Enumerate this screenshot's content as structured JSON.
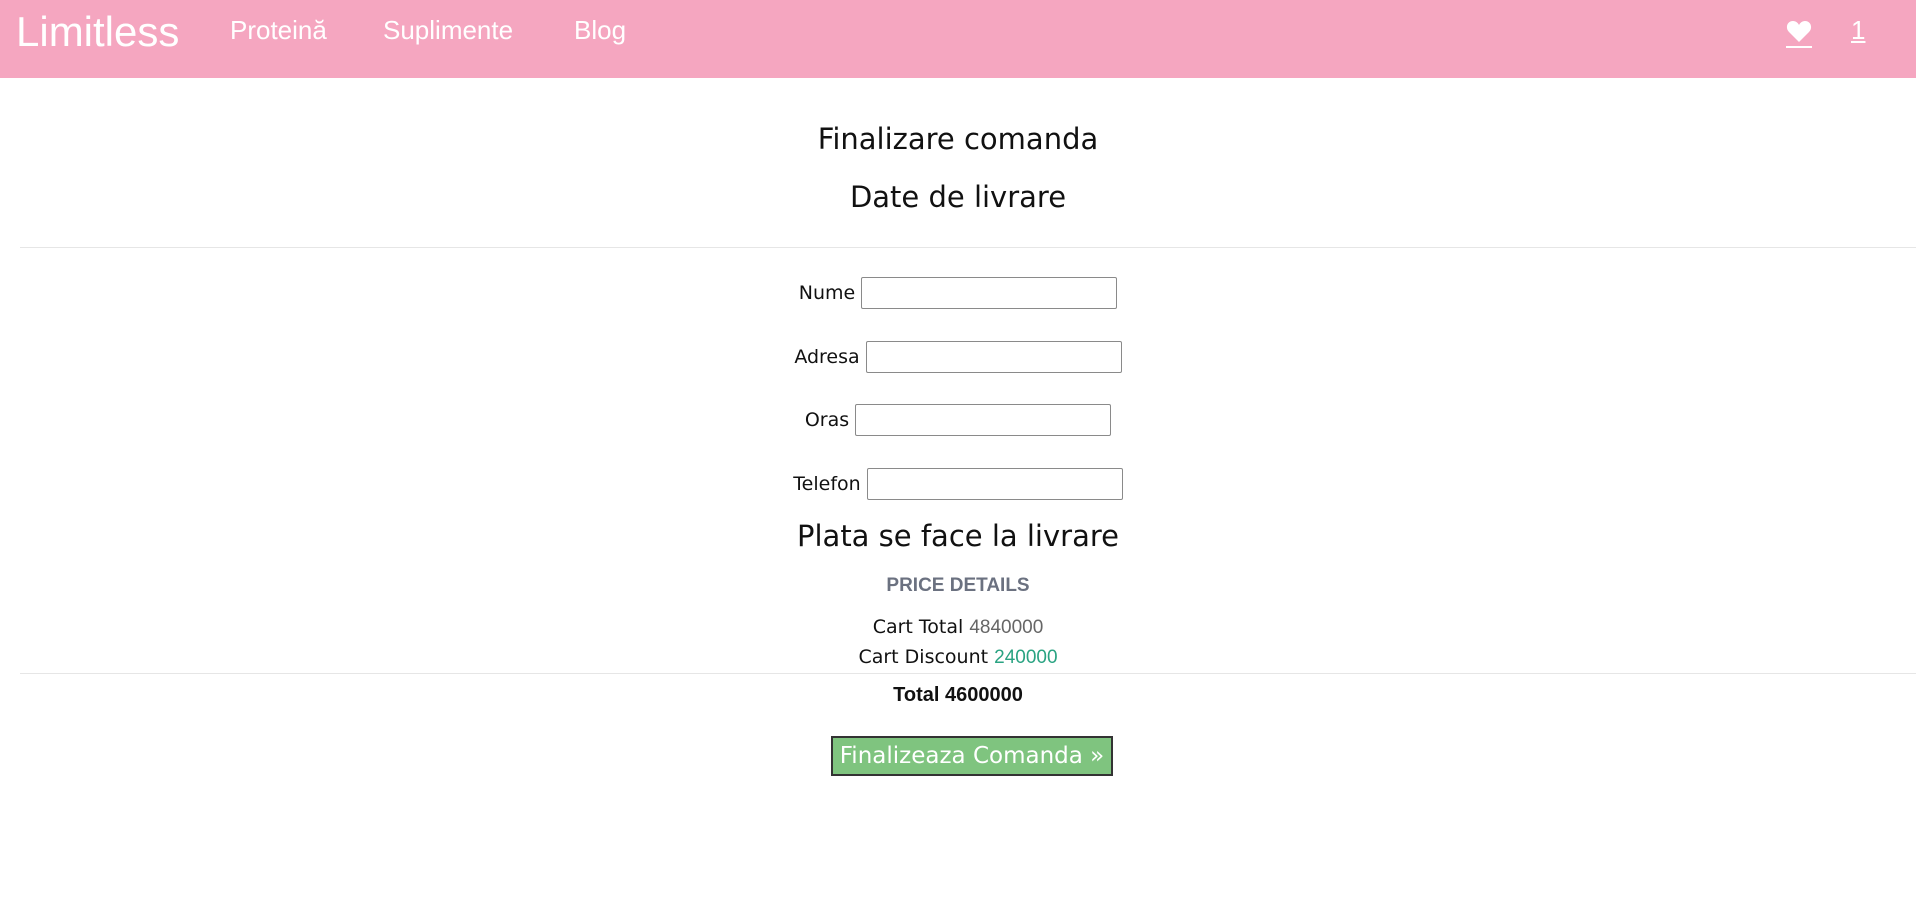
{
  "navbar": {
    "brand": "Limitless",
    "links": [
      "Proteină",
      "Suplimente",
      "Blog"
    ],
    "cart_count": "1",
    "background_color": "#f5a6c0",
    "favorites_icon": "heart-icon"
  },
  "checkout": {
    "title": "Finalizare comanda",
    "subtitle": "Date de livrare",
    "fields": [
      {
        "label": "Nume",
        "value": ""
      },
      {
        "label": "Adresa",
        "value": ""
      },
      {
        "label": "Oras",
        "value": ""
      },
      {
        "label": "Telefon",
        "value": ""
      }
    ],
    "payment_note": "Plata se face la livrare"
  },
  "price_details": {
    "title": "PRICE DETAILS",
    "cart_total_label": "Cart Total",
    "cart_total_value": "4840000",
    "cart_discount_label": "Cart Discount",
    "cart_discount_value": "240000",
    "total_label": "Total",
    "total_value": "4600000",
    "discount_color": "#2aa382"
  },
  "actions": {
    "submit_label": "Finalizeaza Comanda »",
    "submit_color": "#7fc47f"
  }
}
